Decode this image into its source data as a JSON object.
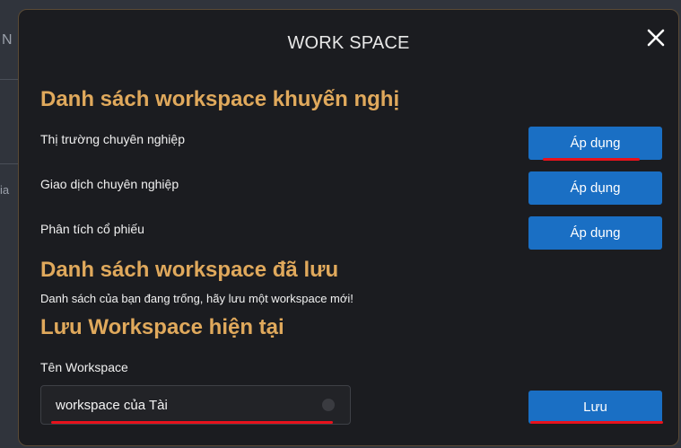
{
  "backdrop": {
    "fragment_top": "N",
    "fragment_mid": "ia"
  },
  "modal": {
    "title": "WORK SPACE",
    "close_icon": "close-icon"
  },
  "recommended": {
    "heading": "Danh sách workspace khuyến nghị",
    "items": [
      {
        "label": "Thị trường chuyên nghiệp",
        "button": "Áp dụng"
      },
      {
        "label": "Giao dịch chuyên nghiệp",
        "button": "Áp dụng"
      },
      {
        "label": "Phân tích cổ phiếu",
        "button": "Áp dụng"
      }
    ]
  },
  "saved": {
    "heading": "Danh sách workspace đã lưu",
    "empty_message": "Danh sách của bạn đang trống, hãy lưu một workspace mới!"
  },
  "save_current": {
    "heading": "Lưu Workspace hiện tại",
    "field_label": "Tên Workspace",
    "field_value": "workspace của Tài",
    "save_button": "Lưu"
  },
  "colors": {
    "accent_heading": "#e0a95c",
    "button_blue": "#1a6fc4",
    "annotation_red": "#e8121c",
    "modal_bg": "#1b1c20"
  }
}
